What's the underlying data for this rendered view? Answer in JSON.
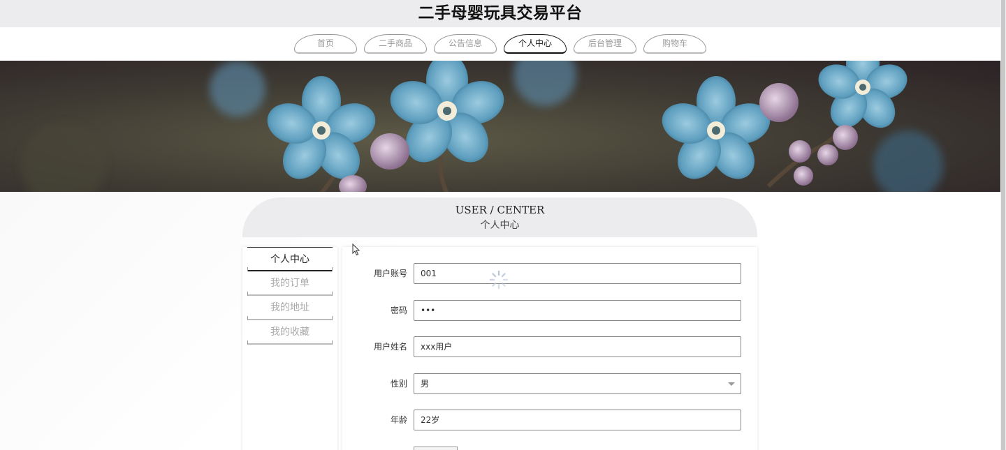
{
  "site": {
    "title": "二手母婴玩具交易平台"
  },
  "nav": {
    "tabs": [
      {
        "label": "首页",
        "active": false
      },
      {
        "label": "二手商品",
        "active": false
      },
      {
        "label": "公告信息",
        "active": false
      },
      {
        "label": "个人中心",
        "active": true
      },
      {
        "label": "后台管理",
        "active": false
      },
      {
        "label": "购物车",
        "active": false
      }
    ]
  },
  "section": {
    "title_en": "USER / CENTER",
    "title_cn": "个人中心"
  },
  "sidebar": {
    "items": [
      {
        "label": "个人中心",
        "active": true
      },
      {
        "label": "我的订单",
        "active": false
      },
      {
        "label": "我的地址",
        "active": false
      },
      {
        "label": "我的收藏",
        "active": false
      }
    ]
  },
  "form": {
    "account": {
      "label": "用户账号",
      "value": "001"
    },
    "password": {
      "label": "密码",
      "value": "•••"
    },
    "name": {
      "label": "用户姓名",
      "value": "xxx用户"
    },
    "gender": {
      "label": "性别",
      "value": "男"
    },
    "age": {
      "label": "年龄",
      "value": "22岁"
    }
  },
  "colors": {
    "accent": "#111111",
    "inactive_text": "#9a9a9a",
    "header_bg": "#ececee",
    "flower_blue": "#6aa7c6"
  },
  "icons": {
    "loading": "spinner-icon",
    "cursor": "mouse-pointer-icon",
    "select": "chevron-down-icon"
  }
}
